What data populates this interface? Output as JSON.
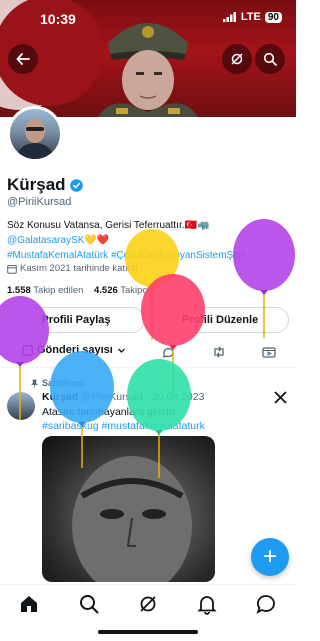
{
  "status": {
    "time": "10:39",
    "network": "LTE",
    "battery": "90"
  },
  "profile": {
    "name": "Kürşad",
    "handle": "@PiriiKursad",
    "bio_line1": "Söz Konusu Vatansa, Gerisi Teferruattır.🇹🇷🦏",
    "bio_link1": "@GalatasaraySK",
    "bio_hearts": "💛❤️",
    "bio_tag1": "#MustafaKemalAtatürk",
    "bio_tag2": "#ÇocuklarıKoruyanSistemŞart",
    "joined": "Kasım 2021 tarihinde katıldı",
    "following_count": "1.558",
    "following_label": "Takip edilen",
    "followers_count": "4.526",
    "followers_label": "Takipçi"
  },
  "buttons": {
    "share": "Profili Paylaş",
    "edit": "Profili Düzenle"
  },
  "tabs": {
    "posts_dropdown": "Gönderi sayısı"
  },
  "pinned_post": {
    "pinned_label": "Sabitlendi",
    "author": "Kürşad",
    "handle_date": "@PiriiKursad · 30.04.2023",
    "text_line1": "Atasını tanımayanlara gelsin.",
    "hashtags": "#saribaskug #mustafakemalataturk"
  },
  "fab": {
    "label": "+"
  },
  "colors": {
    "accent": "#1d9bf0",
    "verified": "#1d9bf0",
    "flag_red": "#a3141a"
  },
  "icons": [
    "back-arrow-icon",
    "grok-icon",
    "search-icon",
    "verified-badge-icon",
    "calendar-icon",
    "pin-icon",
    "retweet-icon",
    "video-icon",
    "x-logo-icon",
    "home-icon",
    "search-nav-icon",
    "grok-nav-icon",
    "notifications-icon",
    "messages-icon"
  ]
}
